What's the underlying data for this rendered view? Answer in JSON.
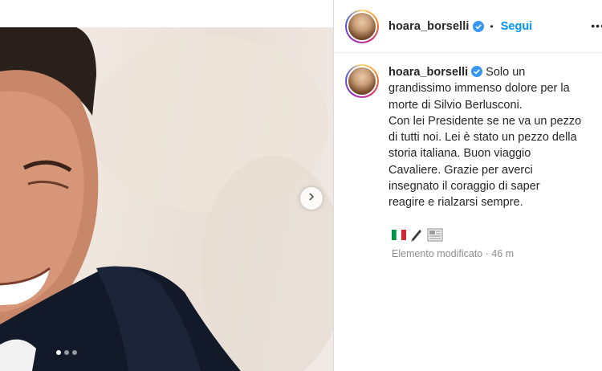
{
  "post": {
    "carousel": {
      "total_slides": 3,
      "current_slide": 1
    }
  },
  "header": {
    "username": "hoara_borselli",
    "separator": "•",
    "follow_label": "Segui",
    "more_label": "•••"
  },
  "caption": {
    "username": "hoara_borselli",
    "text": "Solo un\ngrandissimo immenso dolore per la\nmorte di Silvio Berlusconi.\nCon lei Presidente se ne va un pezzo\ndi tutti noi. Lei è stato un pezzo della\nstoria italiana. Buon viaggio\nCavaliere. Grazie per averci\ninsegnato il coraggio di saper\nreagire e rialzarsi sempre.",
    "emojis": [
      "flag-italy-icon",
      "pen-icon",
      "newspaper-icon"
    ],
    "meta": "Elemento modificato · 46 m"
  },
  "colors": {
    "follow_blue": "#0095f6",
    "verified_blue": "#3897f0",
    "meta_gray": "#8e8e8e"
  }
}
